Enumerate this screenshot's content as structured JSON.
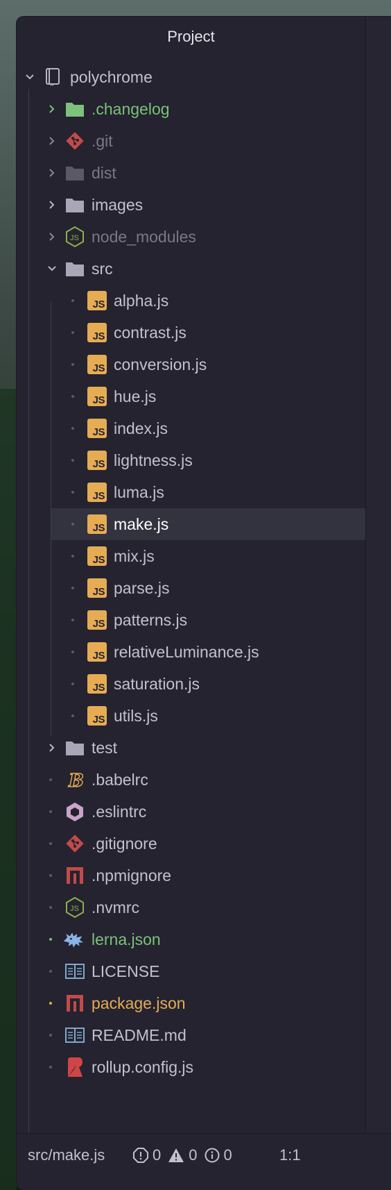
{
  "panel": {
    "title": "Project"
  },
  "tree": {
    "root": {
      "label": "polychrome",
      "icon": "repo-icon"
    },
    "folders": {
      "changelog": ".changelog",
      "git": ".git",
      "dist": "dist",
      "images": "images",
      "node_modules": "node_modules",
      "src": "src",
      "test": "test"
    },
    "src_files": [
      "alpha.js",
      "contrast.js",
      "conversion.js",
      "hue.js",
      "index.js",
      "lightness.js",
      "luma.js",
      "make.js",
      "mix.js",
      "parse.js",
      "patterns.js",
      "relativeLuminance.js",
      "saturation.js",
      "utils.js"
    ],
    "root_files": {
      "babelrc": ".babelrc",
      "eslintrc": ".eslintrc",
      "gitignore": ".gitignore",
      "npmignore": ".npmignore",
      "nvmrc": ".nvmrc",
      "lerna": "lerna.json",
      "license": "LICENSE",
      "package": "package.json",
      "readme": "README.md",
      "rollup": "rollup.config.js"
    },
    "selected_file": "make.js"
  },
  "status": {
    "file_path": "src/make.js",
    "errors": "0",
    "warnings": "0",
    "infos": "0",
    "cursor": "1:1"
  },
  "colors": {
    "background": "#24232f",
    "selection": "#33323f",
    "text": "#c4c1cf",
    "dim_text": "#7a7886",
    "added_green": "#7cc27a",
    "modified_orange": "#e6ac54",
    "js_badge": "#e6ac54",
    "git_red": "#c24a4a",
    "node_green": "#8cb04f"
  }
}
